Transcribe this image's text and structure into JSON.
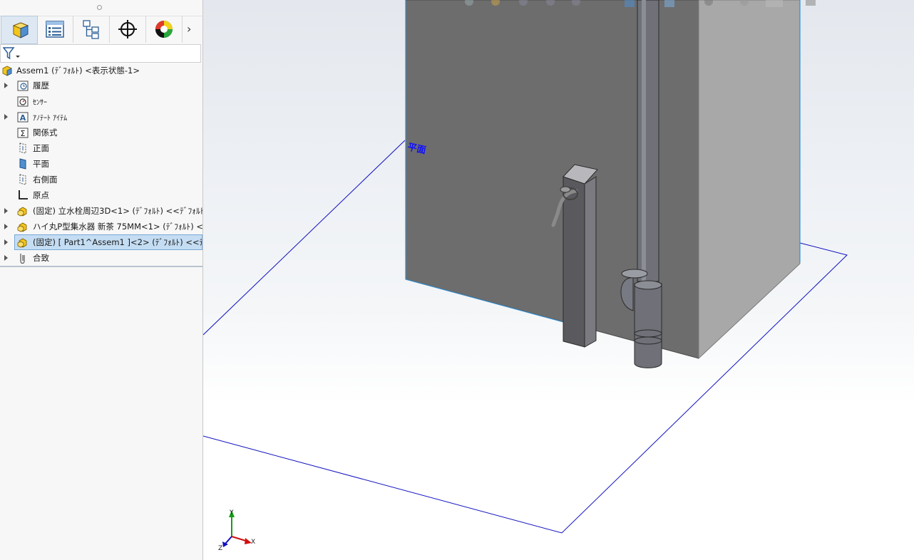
{
  "colors": {
    "accent": "#c4ddf3",
    "plane_line": "#1010c0",
    "wall_front": "#6d6d6d",
    "wall_side": "#a6a6a6",
    "part_yellow": "#f3c51b"
  },
  "toolbar_tabs": [
    {
      "icon": "featuremanager-icon",
      "active": true
    },
    {
      "icon": "propertymanager-icon",
      "active": false
    },
    {
      "icon": "configurationmanager-icon",
      "active": false
    },
    {
      "icon": "dimxpert-icon",
      "active": false
    },
    {
      "icon": "displaymanager-icon",
      "active": false
    }
  ],
  "tree": {
    "root": "Assem1 (ﾃﾞﾌｫﾙﾄ) <表示状態-1>",
    "items": [
      {
        "label": "履歴",
        "icon": "history-folder-icon",
        "expandable": true
      },
      {
        "label": "ｾﾝｻｰ",
        "icon": "sensor-icon",
        "expandable": false
      },
      {
        "label": "ｱﾉﾃｰﾄ ｱｲﾃﾑ",
        "icon": "annotation-icon",
        "expandable": true
      },
      {
        "label": "関係式",
        "icon": "equation-icon",
        "expandable": false
      },
      {
        "label": "正面",
        "icon": "plane-icon",
        "expandable": false
      },
      {
        "label": "平面",
        "icon": "plane-selected-icon",
        "expandable": false
      },
      {
        "label": "右側面",
        "icon": "plane-icon",
        "expandable": false
      },
      {
        "label": "原点",
        "icon": "origin-icon",
        "expandable": false
      },
      {
        "label": "(固定) 立水栓周辺3D<1> (ﾃﾞﾌｫﾙﾄ) <<ﾃﾞﾌｫﾙﾄ>",
        "icon": "subassembly-icon",
        "expandable": true
      },
      {
        "label": "ハイ丸P型集水器 新茶 75MM<1> (ﾃﾞﾌｫﾙﾄ) <<",
        "icon": "subassembly-icon",
        "expandable": true
      },
      {
        "label": "(固定) [ Part1^Assem1 ]<2> (ﾃﾞﾌｫﾙﾄ) <<ﾃﾞﾌｫﾙ",
        "icon": "part-icon",
        "expandable": true,
        "selected": true
      },
      {
        "label": "合致",
        "icon": "mates-icon",
        "expandable": true
      }
    ]
  },
  "viewport": {
    "plane_label": "平面",
    "triad": {
      "x": "X",
      "y": "Y",
      "z": "Z"
    }
  }
}
